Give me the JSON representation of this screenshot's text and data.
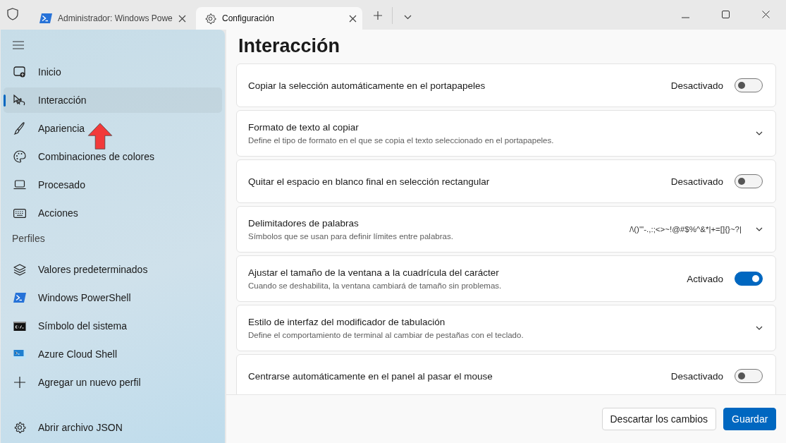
{
  "tabs": [
    {
      "label": "Administrador: Windows Powe",
      "selected": false
    },
    {
      "label": "Configuración",
      "selected": true
    }
  ],
  "sidebar": {
    "items": [
      {
        "label": "Inicio",
        "selected": false
      },
      {
        "label": "Interacción",
        "selected": true
      },
      {
        "label": "Apariencia",
        "selected": false
      },
      {
        "label": "Combinaciones de colores",
        "selected": false
      },
      {
        "label": "Procesado",
        "selected": false
      },
      {
        "label": "Acciones",
        "selected": false
      }
    ],
    "section_header": "Perfiles",
    "profiles": [
      {
        "label": "Valores predeterminados"
      },
      {
        "label": "Windows PowerShell"
      },
      {
        "label": "Símbolo del sistema"
      },
      {
        "label": "Azure Cloud Shell"
      },
      {
        "label": "Agregar un nuevo perfil"
      }
    ],
    "footer_item": "Abrir archivo JSON"
  },
  "page_title": "Interacción",
  "settings": [
    {
      "kind": "toggle",
      "title": "Copiar la selección automáticamente en el portapapeles",
      "state_label": "Desactivado",
      "on": false
    },
    {
      "kind": "expander",
      "title": "Formato de texto al copiar",
      "description": "Define el tipo de formato en el que se copia el texto seleccionado en el portapapeles."
    },
    {
      "kind": "toggle",
      "title": "Quitar el espacio en blanco final en selección rectangular",
      "state_label": "Desactivado",
      "on": false
    },
    {
      "kind": "expander",
      "title": "Delimitadores de palabras",
      "description": "Símbolos que se usan para definir límites entre palabras.",
      "value": "/\\()\"'-.,:;<>~!@#$%^&*|+=[]{}~?|"
    },
    {
      "kind": "toggle",
      "title": "Ajustar el tamaño de la ventana a la cuadrícula del carácter",
      "description": "Cuando se deshabilita, la ventana cambiará de tamaño sin problemas.",
      "state_label": "Activado",
      "on": true
    },
    {
      "kind": "expander",
      "title": "Estilo de interfaz del modificador de tabulación",
      "description": "Define el comportamiento de terminal al cambiar de pestañas con el teclado."
    },
    {
      "kind": "toggle",
      "title": "Centrarse automáticamente en el panel al pasar el mouse",
      "state_label": "Desactivado",
      "on": false
    }
  ],
  "buttons": [
    {
      "label": "Descartar los cambios",
      "kind": "secondary"
    },
    {
      "label": "Guardar",
      "kind": "primary"
    }
  ]
}
